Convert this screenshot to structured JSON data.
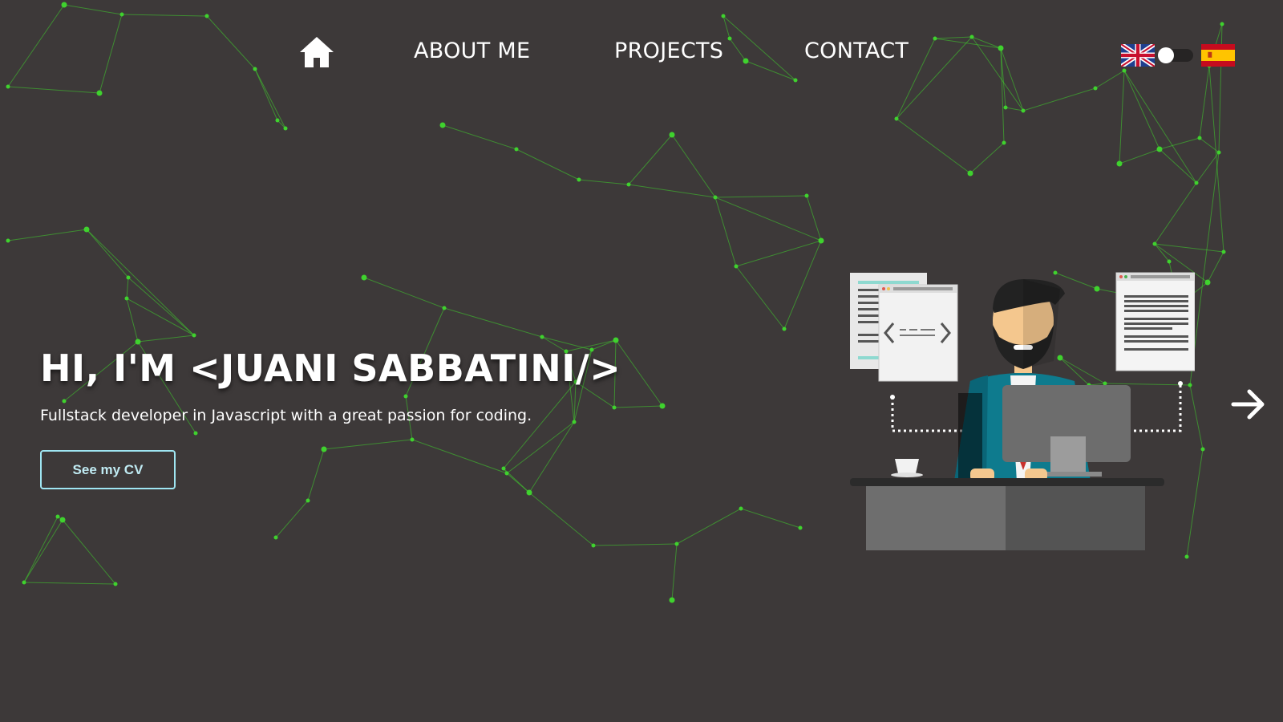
{
  "nav": {
    "home_icon": "home-icon",
    "items": [
      {
        "label": "ABOUT ME"
      },
      {
        "label": "PROJECTS"
      },
      {
        "label": "CONTACT"
      }
    ]
  },
  "language": {
    "options": [
      "uk-flag-icon",
      "spain-flag-icon"
    ],
    "toggle_state": "off"
  },
  "hero": {
    "title": "HI, I'M <JUANI SABBATINI/>",
    "subtitle": "Fullstack developer in Javascript with a great passion for coding.",
    "cv_button": "See my CV"
  },
  "carousel": {
    "next_icon": "arrow-right-icon"
  },
  "colors": {
    "background": "#3d3939",
    "network_green": "#3fd22e",
    "button_border": "#9fe6f2"
  }
}
